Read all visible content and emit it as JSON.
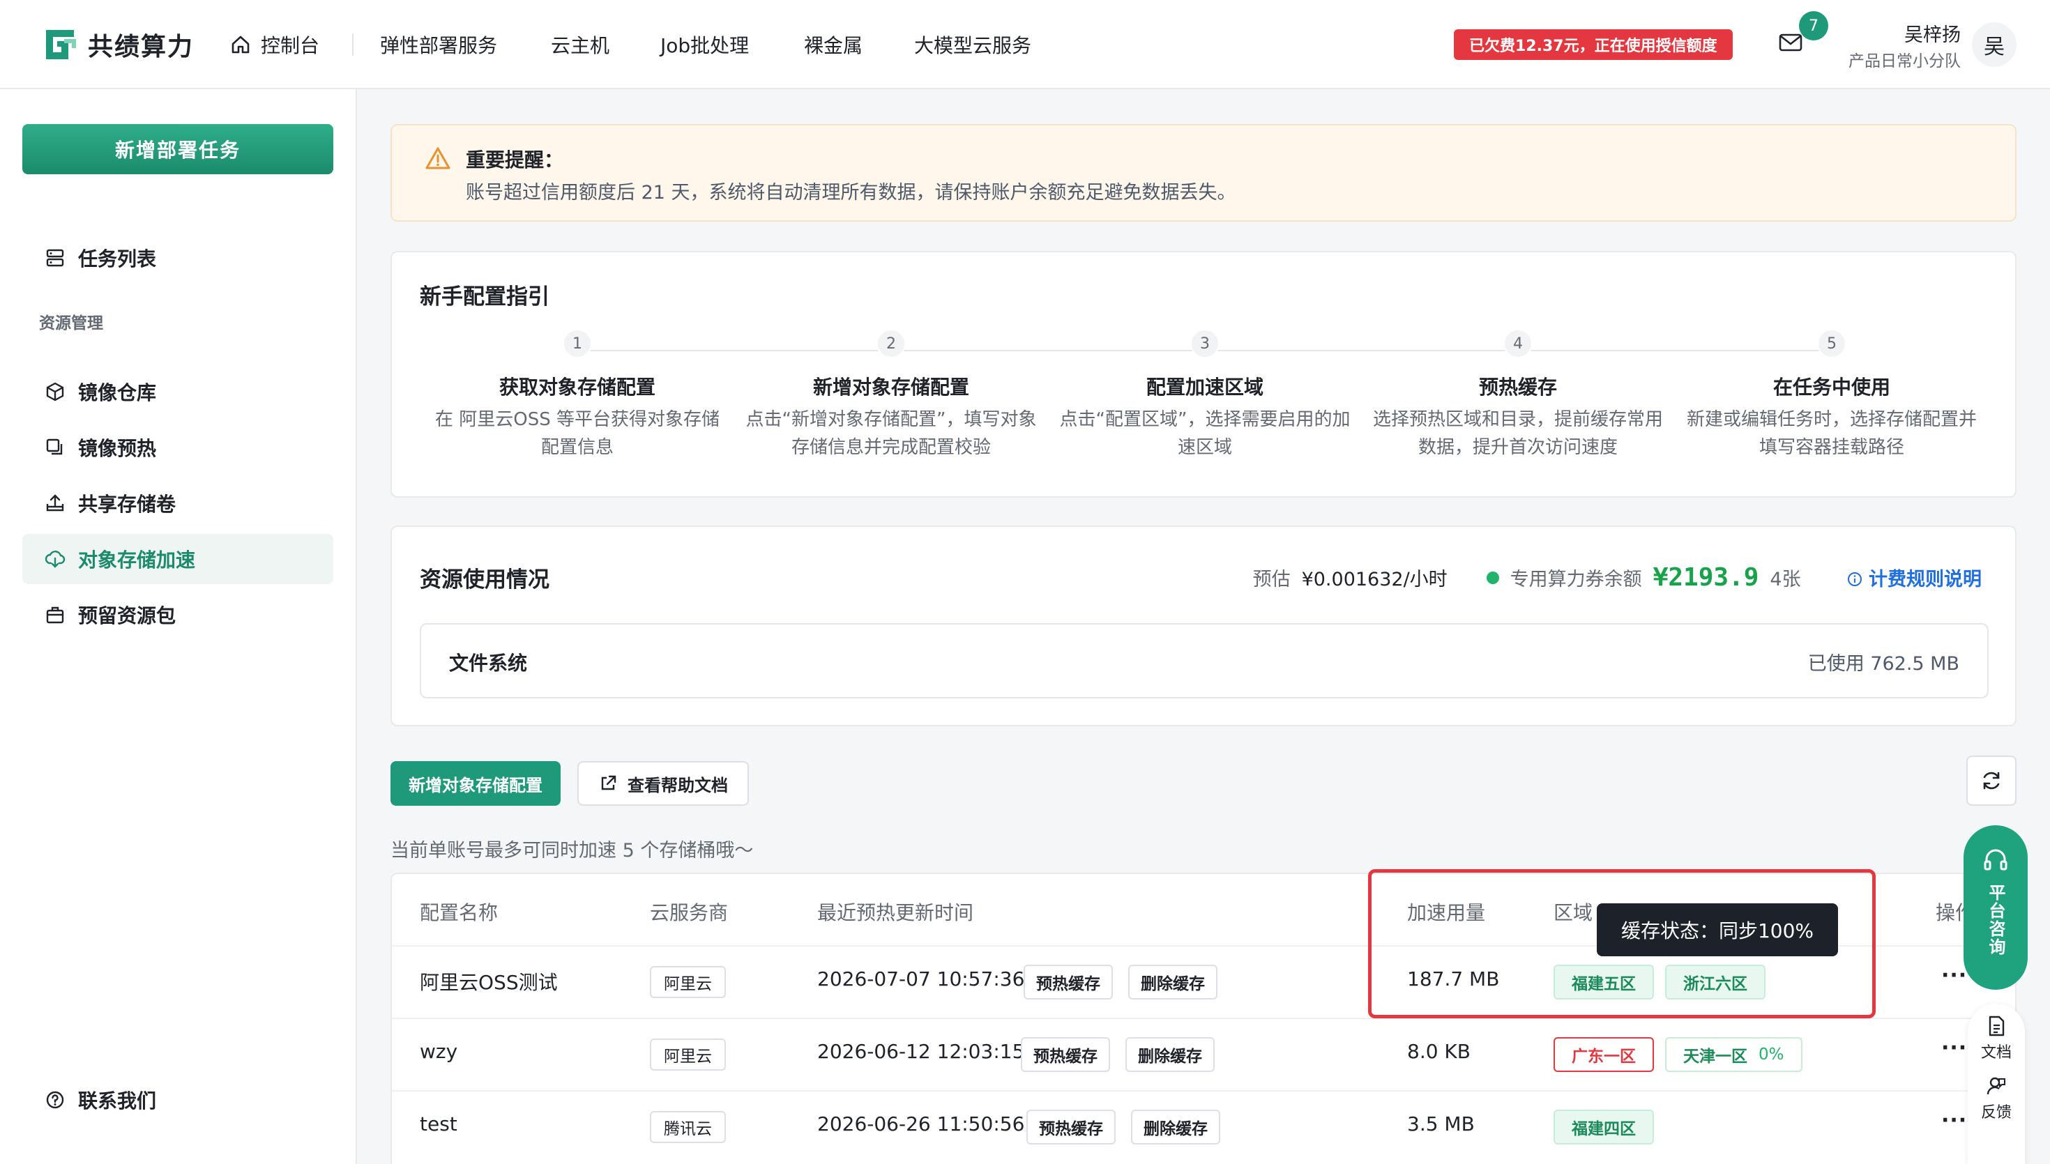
{
  "brand": {
    "name": "共绩算力",
    "color": "#1e9a7a"
  },
  "nav": {
    "home": "控制台",
    "items": [
      "弹性部署服务",
      "云主机",
      "Job批处理",
      "裸金属",
      "大模型云服务"
    ]
  },
  "header": {
    "arrears": "已欠费12.37元，正在使用授信额度",
    "mail_count": "7",
    "user_name": "吴梓扬",
    "user_team": "产品日常小分队",
    "avatar": "吴"
  },
  "sidebar": {
    "new_task": "新增部署任务",
    "task_list": "任务列表",
    "group_resources": "资源管理",
    "items": [
      "镜像仓库",
      "镜像预热",
      "共享存储卷",
      "对象存储加速",
      "预留资源包"
    ],
    "contact": "联系我们"
  },
  "alert": {
    "title": "重要提醒：",
    "text": "账号超过信用额度后 21 天，系统将自动清理所有数据，请保持账户余额充足避免数据丢失。"
  },
  "guide": {
    "title": "新手配置指引",
    "steps": [
      {
        "num": "1",
        "title": "获取对象存储配置",
        "desc": "在 阿里云OSS 等平台获得对象存储配置信息"
      },
      {
        "num": "2",
        "title": "新增对象存储配置",
        "desc": "点击“新增对象存储配置”，填写对象存储信息并完成配置校验"
      },
      {
        "num": "3",
        "title": "配置加速区域",
        "desc": "点击“配置区域”，选择需要启用的加速区域"
      },
      {
        "num": "4",
        "title": "预热缓存",
        "desc": "选择预热区域和目录，提前缓存常用数据，提升首次访问速度"
      },
      {
        "num": "5",
        "title": "在任务中使用",
        "desc": "新建或编辑任务时，选择存储配置并填写容器挂载路径"
      }
    ]
  },
  "usage": {
    "title": "资源使用情况",
    "estimate_label": "预估",
    "estimate_value": "¥0.001632/小时",
    "balance_label": "专用算力券余额",
    "balance_value": "¥2193.9",
    "balance_count": "4张",
    "billing_link": "计费规则说明",
    "fs_label": "文件系统",
    "fs_used": "已使用 762.5 MB"
  },
  "actions": {
    "add_config": "新增对象存储配置",
    "help_doc": "查看帮助文档",
    "hint": "当前单账号最多可同时加速 5 个存储桶哦～"
  },
  "table": {
    "headers": [
      "配置名称",
      "云服务商",
      "最近预热更新时间",
      "加速用量",
      "区域",
      "操作"
    ],
    "warm_label": "预热缓存",
    "delete_label": "删除缓存",
    "rows": [
      {
        "name": "阿里云OSS测试",
        "vendor": "阿里云",
        "time": "2026-07-07 10:57:36",
        "usage": "187.7 MB",
        "regions": [
          {
            "label": "福建五区",
            "style": "green"
          },
          {
            "label": "浙江六区",
            "style": "green"
          }
        ]
      },
      {
        "name": "wzy",
        "vendor": "阿里云",
        "time": "2026-06-12 12:03:15",
        "usage": "8.0 KB",
        "regions": [
          {
            "label": "广东一区",
            "style": "red"
          },
          {
            "label": "天津一区",
            "style": "greenline",
            "pct": "0%"
          }
        ]
      },
      {
        "name": "test",
        "vendor": "腾讯云",
        "time": "2026-06-26 11:50:56",
        "usage": "3.5 MB",
        "regions": [
          {
            "label": "福建四区",
            "style": "green"
          }
        ]
      }
    ],
    "more": "···"
  },
  "tooltip": "缓存状态：同步100%",
  "float": {
    "consult": "平台咨询",
    "docs": "文档",
    "feedback": "反馈"
  }
}
